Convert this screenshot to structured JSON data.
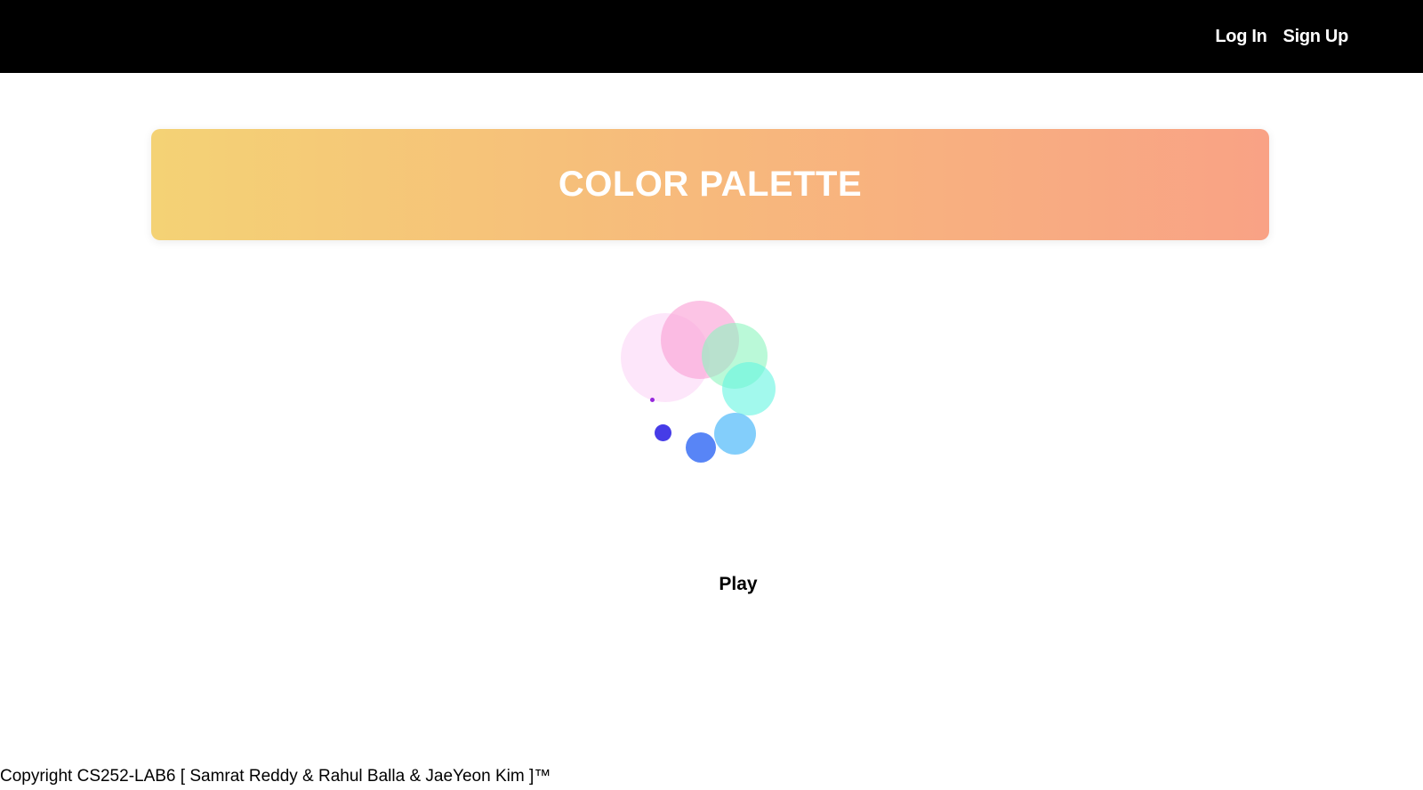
{
  "nav": {
    "login_label": "Log In",
    "signup_label": "Sign Up"
  },
  "banner": {
    "title": "COLOR PALETTE",
    "gradient_start": "#f4d275",
    "gradient_end": "#f9a285"
  },
  "palette": {
    "circles": [
      {
        "name": "light-pink-circle",
        "color": "rgba(252,210,245,0.55)"
      },
      {
        "name": "pink-circle",
        "color": "rgba(251,165,215,0.65)"
      },
      {
        "name": "mint-circle",
        "color": "rgba(140,245,190,0.6)"
      },
      {
        "name": "aqua-circle",
        "color": "rgba(100,245,225,0.6)"
      },
      {
        "name": "sky-blue-circle",
        "color": "rgba(90,190,250,0.75)"
      },
      {
        "name": "blue-circle",
        "color": "rgba(70,120,245,0.9)"
      },
      {
        "name": "indigo-circle",
        "color": "rgba(60,50,230,0.95)"
      },
      {
        "name": "violet-dot",
        "color": "rgba(150,40,220,1)"
      }
    ]
  },
  "controls": {
    "play_label": "Play"
  },
  "footer": {
    "text": "Copyright CS252-LAB6 [ Samrat Reddy & Rahul Balla & JaeYeon Kim ]™"
  }
}
